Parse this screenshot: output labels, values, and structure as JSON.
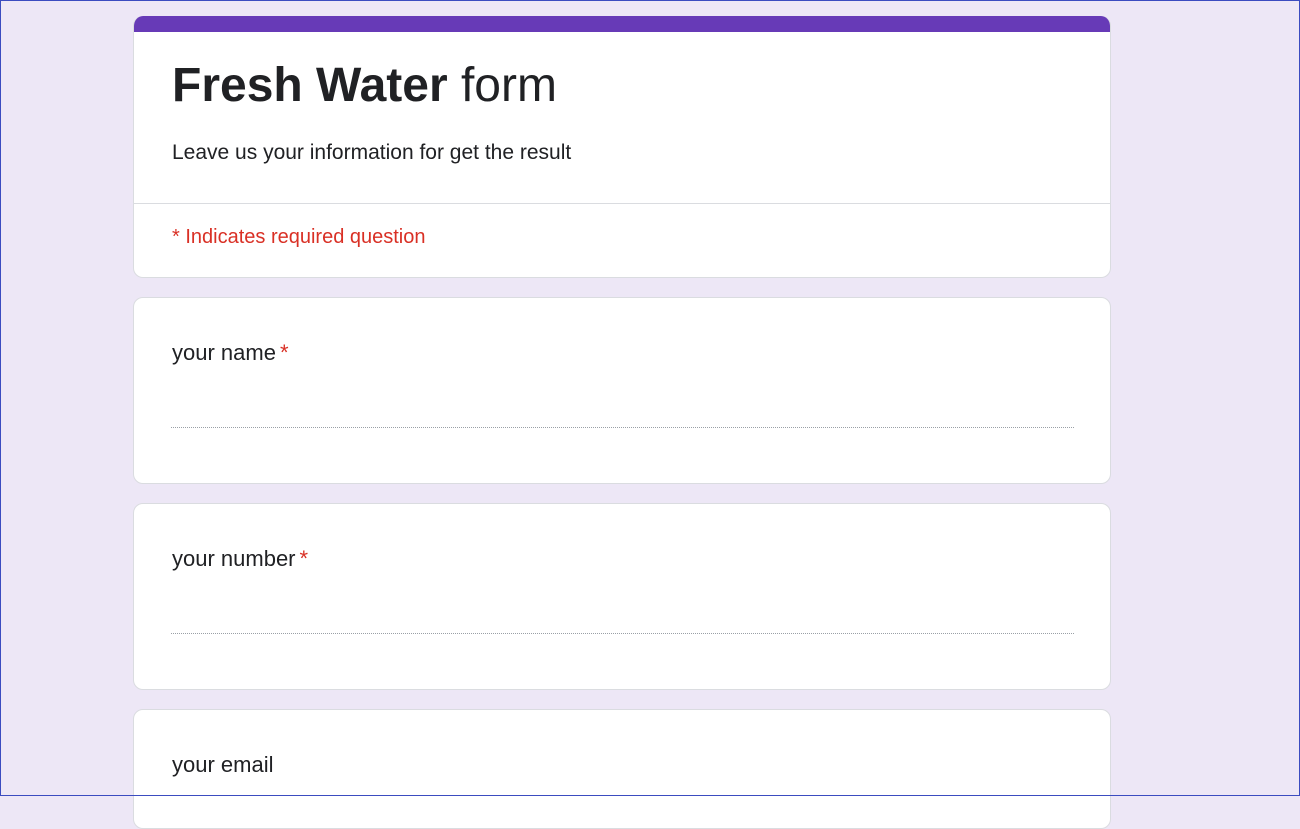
{
  "form": {
    "title_bold": "Fresh Water",
    "title_rest": " form",
    "description": "Leave us your information for get the result",
    "required_note": "* Indicates required question",
    "accent_color": "#673ab7",
    "background_color": "#ede7f6",
    "required_color": "#d93025"
  },
  "questions": [
    {
      "label": "your name",
      "required_mark": "*",
      "value": "",
      "placeholder": ""
    },
    {
      "label": "your number",
      "required_mark": "*",
      "value": "",
      "placeholder": ""
    },
    {
      "label": "your email",
      "required_mark": "",
      "value": "",
      "placeholder": ""
    }
  ]
}
